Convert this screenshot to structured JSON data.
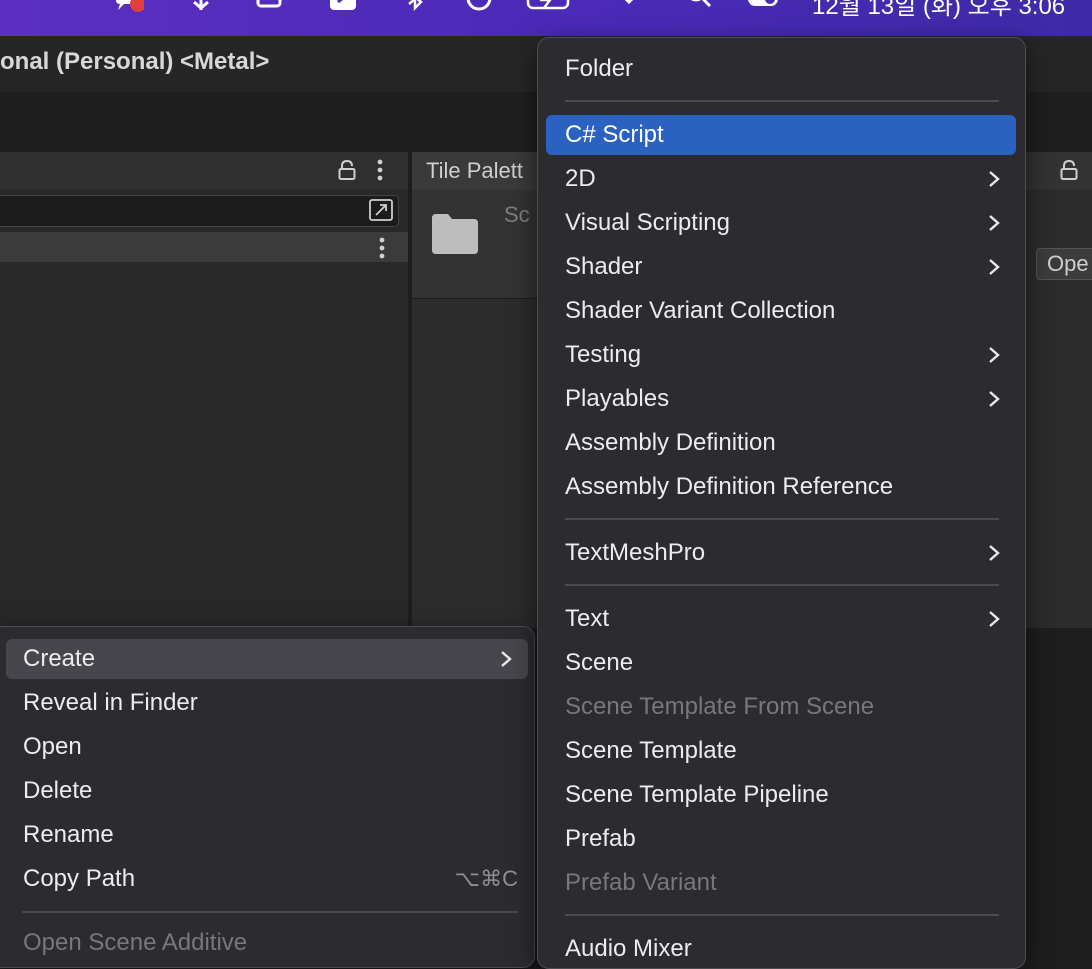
{
  "menubar": {
    "icons": [
      "notification-icon",
      "dropbox-icon",
      "window-icon",
      "screenshot-icon",
      "bluetooth-icon",
      "timer-icon",
      "battery-icon",
      "wifi-icon",
      "search-icon",
      "control-center-icon"
    ],
    "clock": "12월 13일 (화) 오후 3:06",
    "badge_color": "#e0413a"
  },
  "window": {
    "title": "onal (Personal) <Metal>"
  },
  "panels": {
    "tile_palette_tab": "Tile Palett",
    "folder_label": "Sc",
    "open_button": "Ope"
  },
  "context_menu": {
    "items": [
      {
        "label": "Create",
        "has_submenu": true,
        "state": "hover"
      },
      {
        "label": "Reveal in Finder"
      },
      {
        "label": "Open"
      },
      {
        "label": "Delete"
      },
      {
        "label": "Rename"
      },
      {
        "label": "Copy Path",
        "shortcut": "⌥⌘C"
      },
      {
        "label": "Open Scene Additive",
        "state": "disabled"
      }
    ]
  },
  "create_submenu": {
    "items": [
      {
        "label": "Folder"
      },
      {
        "label": "C# Script",
        "state": "selected"
      },
      {
        "label": "2D",
        "has_submenu": true
      },
      {
        "label": "Visual Scripting",
        "has_submenu": true
      },
      {
        "label": "Shader",
        "has_submenu": true
      },
      {
        "label": "Shader Variant Collection"
      },
      {
        "label": "Testing",
        "has_submenu": true
      },
      {
        "label": "Playables",
        "has_submenu": true
      },
      {
        "label": "Assembly Definition"
      },
      {
        "label": "Assembly Definition Reference"
      },
      {
        "label": "TextMeshPro",
        "has_submenu": true
      },
      {
        "label": "Text",
        "has_submenu": true
      },
      {
        "label": "Scene"
      },
      {
        "label": "Scene Template From Scene",
        "state": "disabled"
      },
      {
        "label": "Scene Template"
      },
      {
        "label": "Scene Template Pipeline"
      },
      {
        "label": "Prefab"
      },
      {
        "label": "Prefab Variant",
        "state": "disabled"
      },
      {
        "label": "Audio Mixer"
      }
    ]
  },
  "colors": {
    "selection": "#2b62c2",
    "menu_bg": "#2b2b30",
    "menubar_accent": "#5c2fc0"
  }
}
